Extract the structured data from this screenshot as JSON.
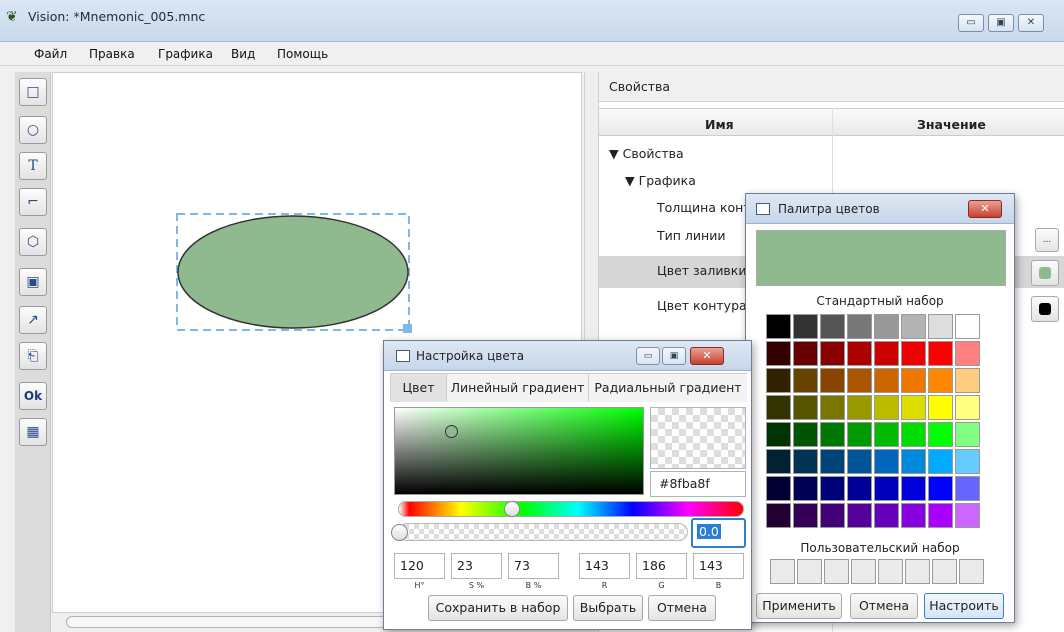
{
  "window": {
    "title": "Vision: *Mnemonic_005.mnc",
    "min": "▭",
    "max": "▣",
    "close": "✕"
  },
  "menu": [
    "Файл",
    "Правка",
    "Графика",
    "Вид",
    "Помощь"
  ],
  "toolbox": [
    {
      "icon": "rectangle-icon",
      "glyph": "□"
    },
    {
      "icon": "ellipse-icon",
      "glyph": "○"
    },
    {
      "icon": "text-icon",
      "glyph": "T"
    },
    {
      "icon": "polyline-icon",
      "glyph": "⌐"
    },
    {
      "icon": "polygon-icon",
      "glyph": "⬡"
    },
    {
      "icon": "image-icon",
      "glyph": "▣"
    },
    {
      "icon": "chart-icon",
      "glyph": "↗"
    },
    {
      "icon": "device-icon",
      "glyph": "⎗"
    },
    {
      "icon": "ok-button-icon",
      "glyph": "Ok"
    },
    {
      "icon": "grid-icon",
      "glyph": "▦"
    }
  ],
  "canvas": {
    "ellipse_fill": "#8fba8f",
    "selection_color": "#7fb8e8"
  },
  "props": {
    "title": "Свойства",
    "col_name": "Имя",
    "col_value": "Значение",
    "rows": [
      "Свойства",
      "Графика",
      "Толщина конт",
      "Тип линии",
      "Цвет заливки",
      "Цвет контура"
    ],
    "more_label": "..."
  },
  "palette": {
    "title": "Палитра цветов",
    "close": "✕",
    "preview_color": "#8fba8f",
    "standard_label": "Стандартный набор",
    "custom_label": "Пользовательский набор",
    "colors": [
      [
        "#000000",
        "#333333",
        "#555555",
        "#777777",
        "#999999",
        "#b3b3b3",
        "#dddddd",
        "#ffffff"
      ],
      [
        "#330000",
        "#660000",
        "#880000",
        "#aa0000",
        "#cc0000",
        "#ee0000",
        "#ff0000",
        "#ff8080"
      ],
      [
        "#332200",
        "#664400",
        "#884400",
        "#aa5500",
        "#cc6600",
        "#ee7700",
        "#ff8800",
        "#ffcc80"
      ],
      [
        "#333300",
        "#555500",
        "#777700",
        "#999900",
        "#bbbb00",
        "#dddd00",
        "#ffff00",
        "#ffff80"
      ],
      [
        "#003300",
        "#005500",
        "#007700",
        "#009900",
        "#00bb00",
        "#00dd00",
        "#00ff00",
        "#80ff80"
      ],
      [
        "#002233",
        "#003355",
        "#004477",
        "#005599",
        "#0066bb",
        "#0088dd",
        "#00aaff",
        "#66ccff"
      ],
      [
        "#000033",
        "#000055",
        "#000077",
        "#000099",
        "#0000bb",
        "#0000dd",
        "#0000ff",
        "#6666ff"
      ],
      [
        "#220033",
        "#330055",
        "#440077",
        "#550099",
        "#6600bb",
        "#8800dd",
        "#aa00ff",
        "#cc66ff"
      ]
    ],
    "apply": "Применить",
    "cancel": "Отмена",
    "configure": "Настроить"
  },
  "colordlg": {
    "title": "Настройка цвета",
    "tabs": [
      "Цвет",
      "Линейный градиент",
      "Радиальный градиент"
    ],
    "hex": "#8fba8f",
    "alpha": "0.0",
    "values": [
      "120",
      "23",
      "73",
      "143",
      "186",
      "143"
    ],
    "labels": [
      "H°",
      "S %",
      "B %",
      "R",
      "G",
      "B"
    ],
    "save": "Сохранить в набор",
    "choose": "Выбрать",
    "cancel": "Отмена",
    "hue_fraction": 0.32
  }
}
